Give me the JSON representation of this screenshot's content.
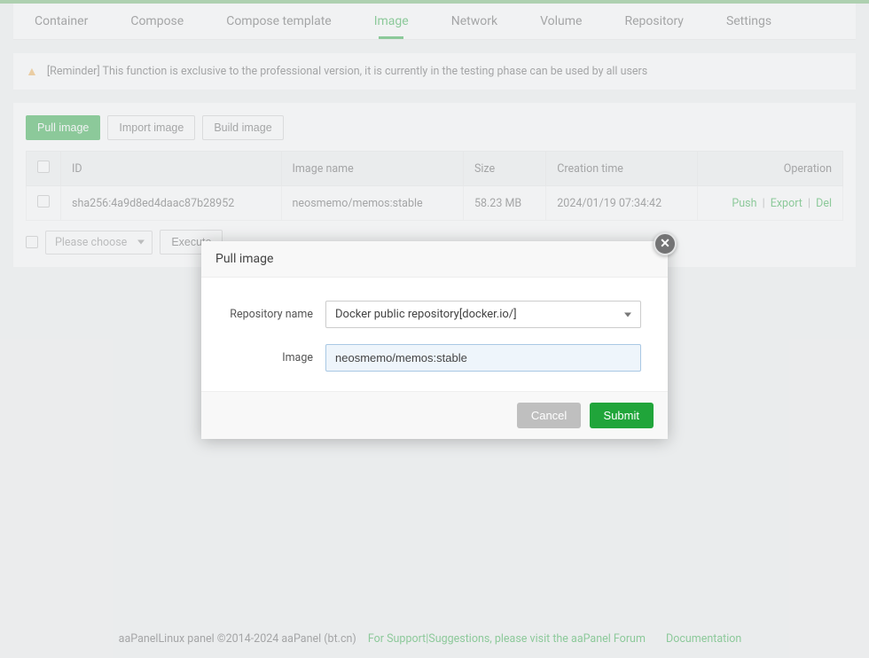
{
  "tabs": {
    "container": "Container",
    "compose": "Compose",
    "compose_template": "Compose template",
    "image": "Image",
    "network": "Network",
    "volume": "Volume",
    "repository": "Repository",
    "settings": "Settings"
  },
  "reminder": "[Reminder] This function is exclusive to the professional version, it is currently in the testing phase can be used by all users",
  "actions": {
    "pull_image": "Pull image",
    "import_image": "Import image",
    "build_image": "Build image"
  },
  "table": {
    "headers": {
      "id": "ID",
      "image_name": "Image name",
      "size": "Size",
      "creation_time": "Creation time",
      "operation": "Operation"
    },
    "rows": [
      {
        "id": "sha256:4a9d8ed4daac87b28952",
        "image_name": "neosmemo/memos:stable",
        "size": "58.23 MB",
        "creation_time": "2024/01/19 07:34:42"
      }
    ],
    "operations": {
      "push": "Push",
      "export": "Export",
      "del": "Del"
    }
  },
  "bottom": {
    "please_choose": "Please choose",
    "execute": "Execute"
  },
  "modal": {
    "title": "Pull image",
    "repository_name_label": "Repository name",
    "repository_value": "Docker public repository[docker.io/]",
    "image_label": "Image",
    "image_value": "neosmemo/memos:stable",
    "cancel": "Cancel",
    "submit": "Submit"
  },
  "footer": {
    "copyright": "aaPanelLinux panel ©2014-2024 aaPanel (bt.cn)",
    "support": "For Support|Suggestions, please visit the aaPanel Forum",
    "documentation": "Documentation"
  }
}
